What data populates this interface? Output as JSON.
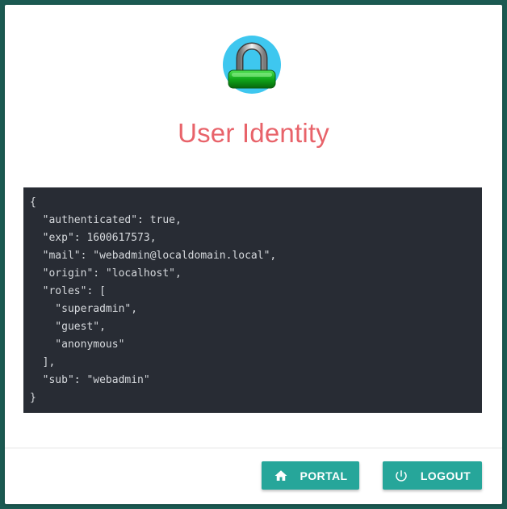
{
  "header": {
    "title": "User Identity",
    "logo_icon": "padlock-icon"
  },
  "identity_json": "{\n  \"authenticated\": true,\n  \"exp\": 1600617573,\n  \"mail\": \"webadmin@localdomain.local\",\n  \"origin\": \"localhost\",\n  \"roles\": [\n    \"superadmin\",\n    \"guest\",\n    \"anonymous\"\n  ],\n  \"sub\": \"webadmin\"\n}",
  "actions": {
    "portal": {
      "label": "PORTAL",
      "icon": "home-icon"
    },
    "logout": {
      "label": "LOGOUT",
      "icon": "power-icon"
    }
  },
  "colors": {
    "background": "#1b5a52",
    "title": "#e8636a",
    "button": "#26a69a",
    "code_background": "#282c34"
  }
}
